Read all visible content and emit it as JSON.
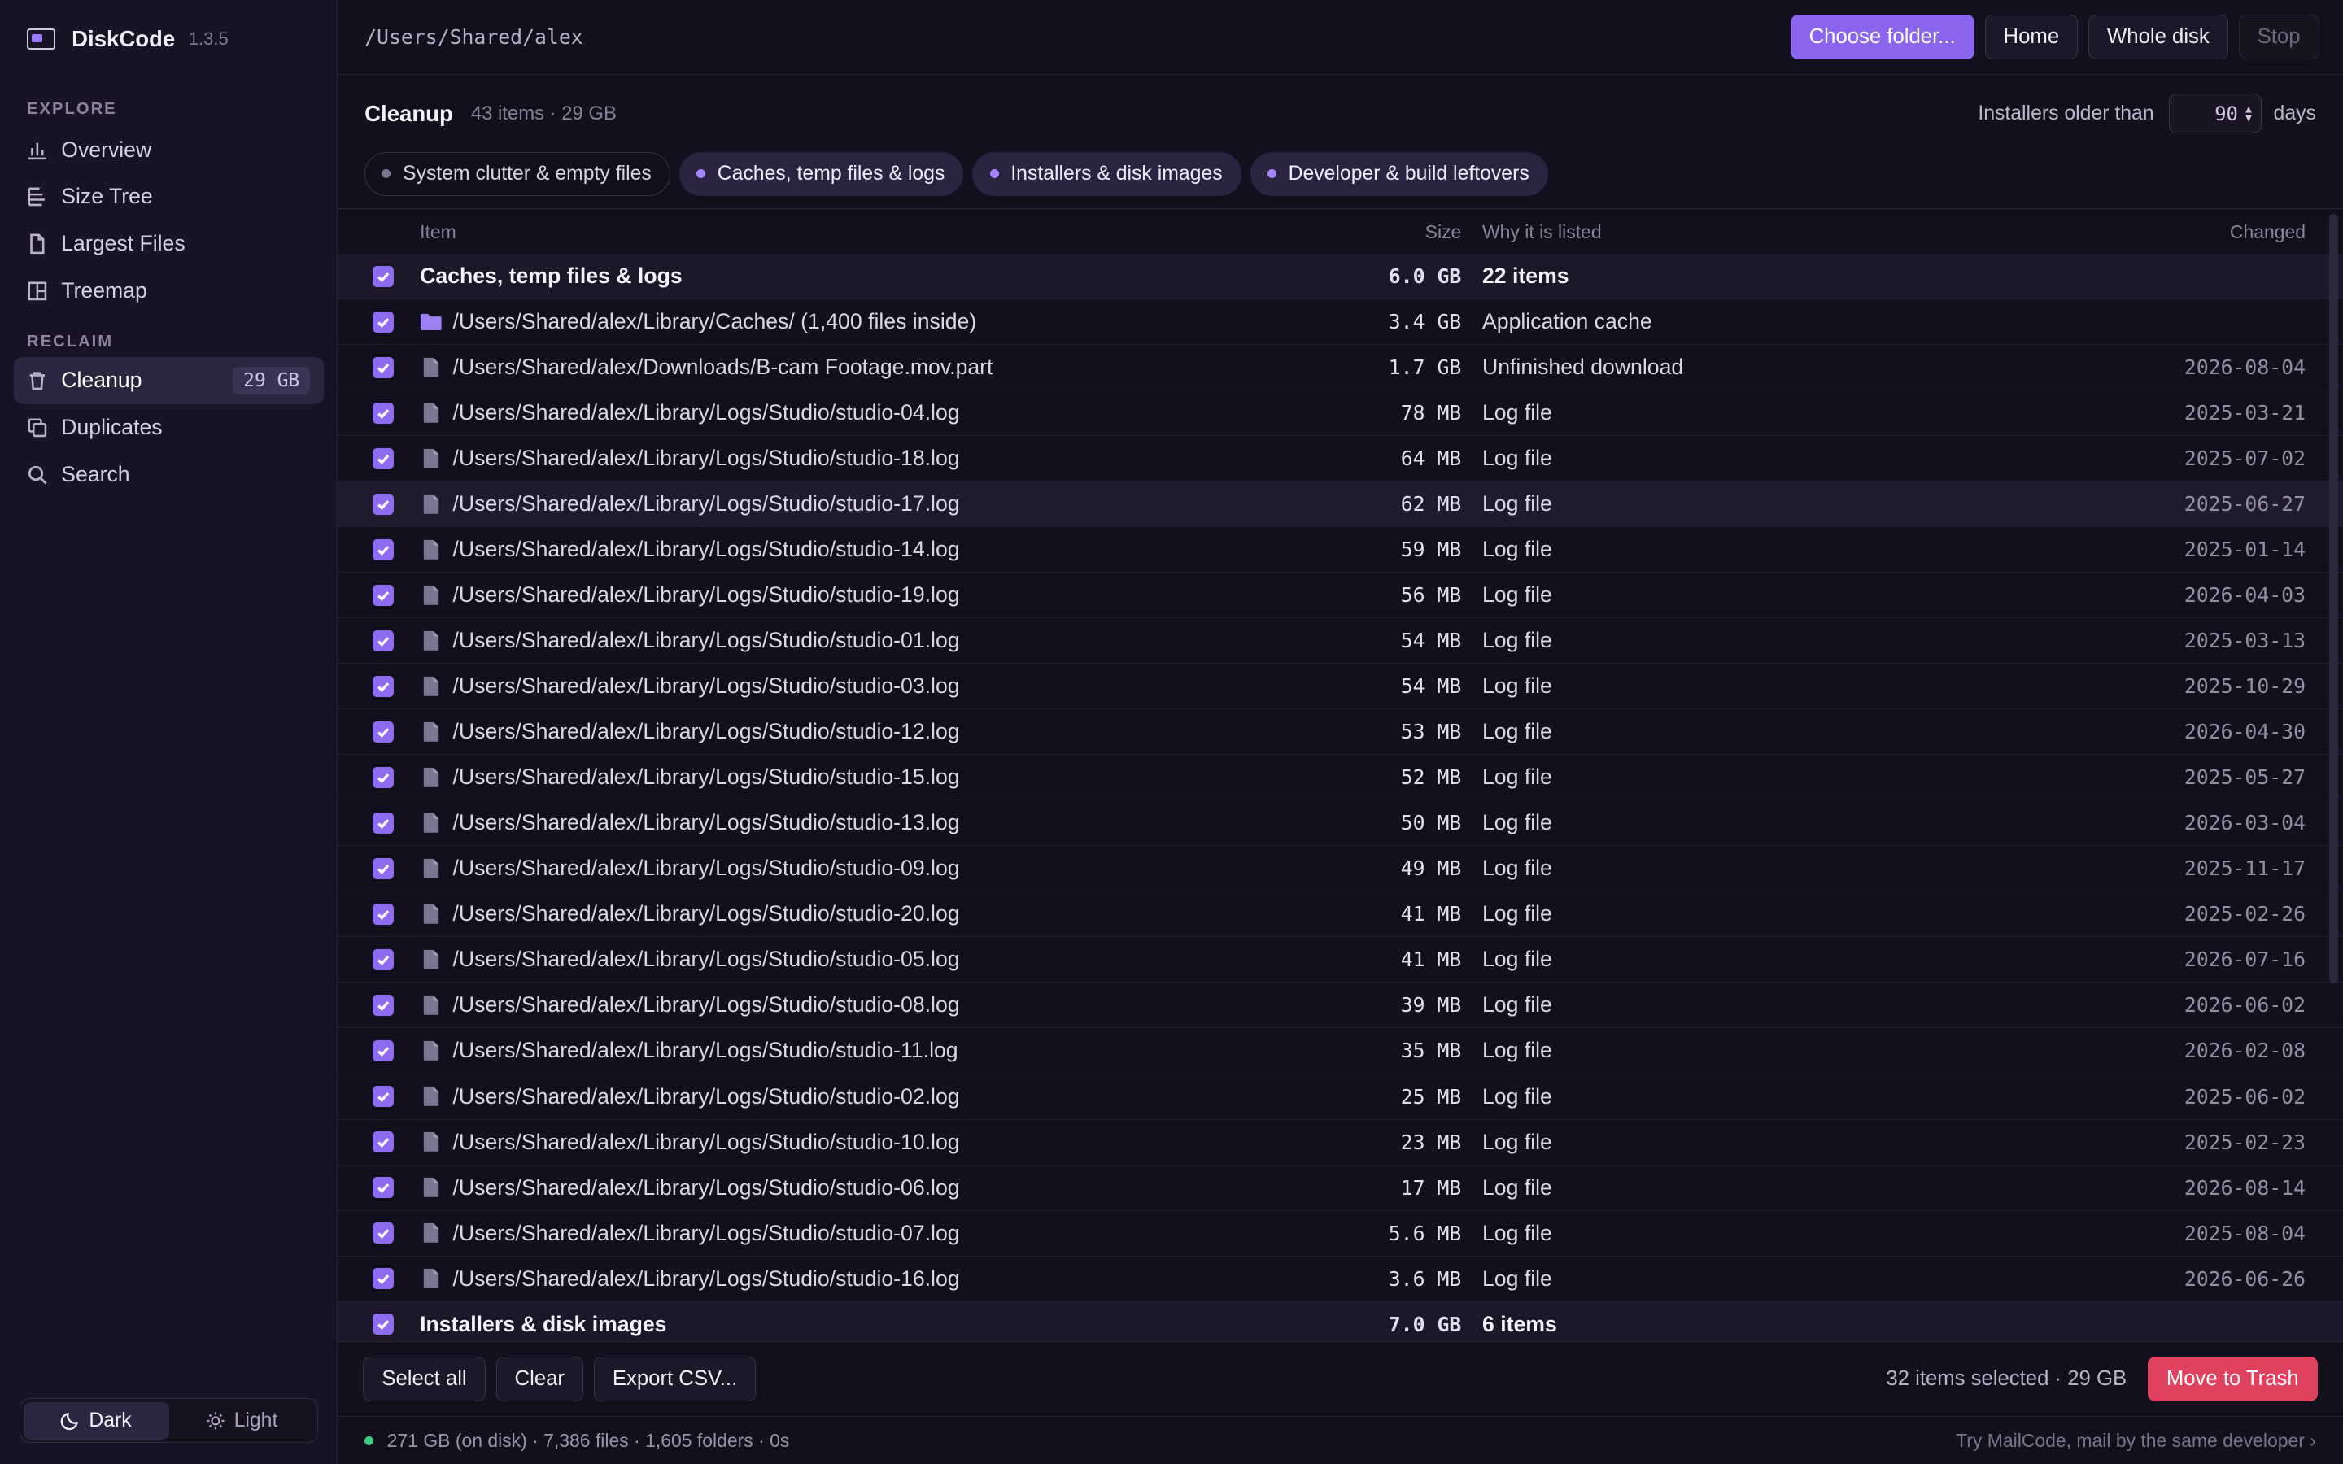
{
  "app": {
    "name": "DiskCode",
    "version": "1.3.5"
  },
  "sidebar": {
    "explore_label": "EXPLORE",
    "explore_items": [
      {
        "label": "Overview",
        "icon": "bar-chart-icon"
      },
      {
        "label": "Size Tree",
        "icon": "tree-icon"
      },
      {
        "label": "Largest Files",
        "icon": "file-icon"
      },
      {
        "label": "Treemap",
        "icon": "treemap-icon"
      }
    ],
    "reclaim_label": "RECLAIM",
    "reclaim_items": [
      {
        "label": "Cleanup",
        "icon": "trash-icon",
        "badge": "29 GB",
        "active": true
      },
      {
        "label": "Duplicates",
        "icon": "duplicates-icon"
      },
      {
        "label": "Search",
        "icon": "search-icon"
      }
    ],
    "theme": {
      "dark_label": "Dark",
      "light_label": "Light",
      "selected": "Dark"
    }
  },
  "topbar": {
    "path": "/Users/Shared/alex",
    "choose_label": "Choose folder...",
    "home_label": "Home",
    "whole_disk_label": "Whole disk",
    "stop_label": "Stop"
  },
  "cleanup": {
    "title": "Cleanup",
    "meta": "43 items · 29 GB",
    "installers_label": "Installers older than",
    "installers_days": "90",
    "days_label": "days",
    "chips": [
      {
        "label": "System clutter & empty files",
        "active": false
      },
      {
        "label": "Caches, temp files & logs",
        "active": true
      },
      {
        "label": "Installers & disk images",
        "active": true
      },
      {
        "label": "Developer & build leftovers",
        "active": true
      }
    ]
  },
  "table": {
    "headers": {
      "item": "Item",
      "size": "Size",
      "why": "Why it is listed",
      "changed": "Changed"
    },
    "rows": [
      {
        "type": "group",
        "item": "Caches, temp files & logs",
        "size": "6.0 GB",
        "why": "22 items",
        "changed": ""
      },
      {
        "type": "folder",
        "item": "/Users/Shared/alex/Library/Caches/ (1,400 files inside)",
        "size": "3.4 GB",
        "why": "Application cache",
        "changed": ""
      },
      {
        "type": "file",
        "item": "/Users/Shared/alex/Downloads/B-cam Footage.mov.part",
        "size": "1.7 GB",
        "why": "Unfinished download",
        "changed": "2026-08-04"
      },
      {
        "type": "file",
        "item": "/Users/Shared/alex/Library/Logs/Studio/studio-04.log",
        "size": "78 MB",
        "why": "Log file",
        "changed": "2025-03-21"
      },
      {
        "type": "file",
        "item": "/Users/Shared/alex/Library/Logs/Studio/studio-18.log",
        "size": "64 MB",
        "why": "Log file",
        "changed": "2025-07-02"
      },
      {
        "type": "file",
        "item": "/Users/Shared/alex/Library/Logs/Studio/studio-17.log",
        "size": "62 MB",
        "why": "Log file",
        "changed": "2025-06-27",
        "highlight": true
      },
      {
        "type": "file",
        "item": "/Users/Shared/alex/Library/Logs/Studio/studio-14.log",
        "size": "59 MB",
        "why": "Log file",
        "changed": "2025-01-14"
      },
      {
        "type": "file",
        "item": "/Users/Shared/alex/Library/Logs/Studio/studio-19.log",
        "size": "56 MB",
        "why": "Log file",
        "changed": "2026-04-03"
      },
      {
        "type": "file",
        "item": "/Users/Shared/alex/Library/Logs/Studio/studio-01.log",
        "size": "54 MB",
        "why": "Log file",
        "changed": "2025-03-13"
      },
      {
        "type": "file",
        "item": "/Users/Shared/alex/Library/Logs/Studio/studio-03.log",
        "size": "54 MB",
        "why": "Log file",
        "changed": "2025-10-29"
      },
      {
        "type": "file",
        "item": "/Users/Shared/alex/Library/Logs/Studio/studio-12.log",
        "size": "53 MB",
        "why": "Log file",
        "changed": "2026-04-30"
      },
      {
        "type": "file",
        "item": "/Users/Shared/alex/Library/Logs/Studio/studio-15.log",
        "size": "52 MB",
        "why": "Log file",
        "changed": "2025-05-27"
      },
      {
        "type": "file",
        "item": "/Users/Shared/alex/Library/Logs/Studio/studio-13.log",
        "size": "50 MB",
        "why": "Log file",
        "changed": "2026-03-04"
      },
      {
        "type": "file",
        "item": "/Users/Shared/alex/Library/Logs/Studio/studio-09.log",
        "size": "49 MB",
        "why": "Log file",
        "changed": "2025-11-17"
      },
      {
        "type": "file",
        "item": "/Users/Shared/alex/Library/Logs/Studio/studio-20.log",
        "size": "41 MB",
        "why": "Log file",
        "changed": "2025-02-26"
      },
      {
        "type": "file",
        "item": "/Users/Shared/alex/Library/Logs/Studio/studio-05.log",
        "size": "41 MB",
        "why": "Log file",
        "changed": "2026-07-16"
      },
      {
        "type": "file",
        "item": "/Users/Shared/alex/Library/Logs/Studio/studio-08.log",
        "size": "39 MB",
        "why": "Log file",
        "changed": "2026-06-02"
      },
      {
        "type": "file",
        "item": "/Users/Shared/alex/Library/Logs/Studio/studio-11.log",
        "size": "35 MB",
        "why": "Log file",
        "changed": "2026-02-08"
      },
      {
        "type": "file",
        "item": "/Users/Shared/alex/Library/Logs/Studio/studio-02.log",
        "size": "25 MB",
        "why": "Log file",
        "changed": "2025-06-02"
      },
      {
        "type": "file",
        "item": "/Users/Shared/alex/Library/Logs/Studio/studio-10.log",
        "size": "23 MB",
        "why": "Log file",
        "changed": "2025-02-23"
      },
      {
        "type": "file",
        "item": "/Users/Shared/alex/Library/Logs/Studio/studio-06.log",
        "size": "17 MB",
        "why": "Log file",
        "changed": "2026-08-14"
      },
      {
        "type": "file",
        "item": "/Users/Shared/alex/Library/Logs/Studio/studio-07.log",
        "size": "5.6 MB",
        "why": "Log file",
        "changed": "2025-08-04"
      },
      {
        "type": "file",
        "item": "/Users/Shared/alex/Library/Logs/Studio/studio-16.log",
        "size": "3.6 MB",
        "why": "Log file",
        "changed": "2026-06-26"
      },
      {
        "type": "group",
        "item": "Installers & disk images",
        "size": "7.0 GB",
        "why": "6 items",
        "changed": ""
      }
    ]
  },
  "footer": {
    "select_all_label": "Select all",
    "clear_label": "Clear",
    "export_label": "Export CSV...",
    "selection_info": "32 items selected · 29 GB",
    "trash_label": "Move to Trash"
  },
  "status": {
    "summary": "271 GB (on disk) · 7,386 files · 1,605 folders · 0s",
    "promo": "Try MailCode, mail by the same developer ›"
  },
  "colors": {
    "accent": "#8b65ee",
    "danger": "#e0415f",
    "status_ok": "#3ccf7e"
  }
}
